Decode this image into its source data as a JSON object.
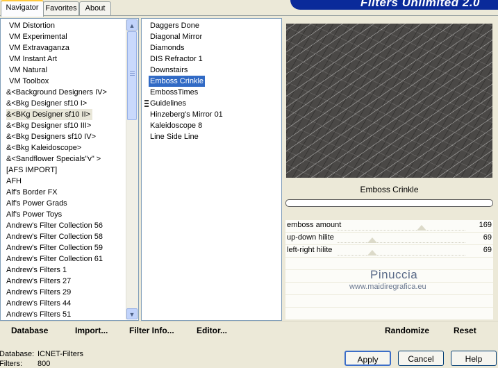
{
  "tabs": [
    "Navigator",
    "Favorites",
    "About"
  ],
  "banner": "Filters Unlimited 2.0",
  "categories": [
    "VM Distortion",
    "VM Experimental",
    "VM Extravaganza",
    "VM Instant Art",
    "VM Natural",
    "VM Toolbox",
    "&<Background Designers IV>",
    "&<Bkg Designer sf10 I>",
    "&<BKg Designer sf10 II>",
    "&<Bkg Designer sf10 III>",
    "&<Bkg Designers sf10 IV>",
    "&<Bkg Kaleidoscope>",
    "&<Sandflower Specials\"v\" >",
    "[AFS IMPORT]",
    "AFH",
    "Alf's Border FX",
    "Alf's Power Grads",
    "Alf's Power Toys",
    "Andrew's Filter Collection 56",
    "Andrew's Filter Collection 58",
    "Andrew's Filter Collection 59",
    "Andrew's Filter Collection 61",
    "Andrew's Filters 1",
    "Andrew's Filters 27",
    "Andrew's Filters 29",
    "Andrew's Filters 44",
    "Andrew's Filters 51"
  ],
  "filters": [
    "Daggers Done",
    "Diagonal Mirror",
    "Diamonds",
    "DIS Refractor 1",
    "Downstairs",
    "Emboss Crinkle",
    "EmbossTimes",
    "Guidelines",
    "Hinzeberg's Mirror 01",
    "Kaleidoscope 8",
    "Line Side Line"
  ],
  "filter_name": "Emboss Crinkle",
  "params": [
    {
      "label": "emboss amount",
      "value": "169",
      "level": 0.66
    },
    {
      "label": "up-down hilite",
      "value": "69",
      "level": 0.27
    },
    {
      "label": "left-right hilite",
      "value": "69",
      "level": 0.27
    }
  ],
  "watermark": {
    "line1": "Pinuccia",
    "line2": "www.maidiregrafica.eu"
  },
  "toolbar": {
    "database": "Database",
    "import": "Import...",
    "filter_info": "Filter Info...",
    "editor": "Editor...",
    "randomize": "Randomize",
    "reset": "Reset"
  },
  "status": {
    "db_label": "Database:",
    "db_value": "ICNET-Filters",
    "filters_label": "Filters:",
    "filters_value": "800"
  },
  "buttons": {
    "apply": "Apply",
    "cancel": "Cancel",
    "help": "Help"
  }
}
